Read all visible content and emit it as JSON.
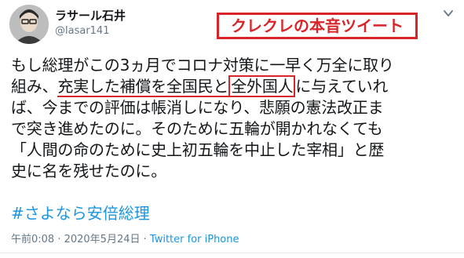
{
  "user": {
    "display_name": "ラサール石井",
    "handle": "@lasar141"
  },
  "banner": {
    "text": "クレクレの本音ツイート",
    "color": "#d9252a"
  },
  "tweet": {
    "line1": "もし総理がこの3ヵ月でコロナ対策に一早く万全に取り",
    "line2_a": "組み、",
    "line2_underlined_1": "充実した",
    "line2_underlined_2": "補償を全国民と",
    "line2_boxed": "全外国人",
    "line2_c": "に与えていれ",
    "line3": "ば、今までの評価は帳消しになり、悲願の憲法改正ま",
    "line4": "で突き進めたのに。そのために五輪が開かれなくても",
    "line5": "「人間の命のために史上初五輪を中止した宰相」と歴",
    "line6": "史に名を残せたのに。",
    "hashtag": "#さよなら安倍総理"
  },
  "meta": {
    "timestamp": "午前0:08 · 2020年5月24日",
    "separator": " · ",
    "source": "Twitter for iPhone"
  },
  "colors": {
    "link": "#1b95e0",
    "muted": "#657786"
  }
}
